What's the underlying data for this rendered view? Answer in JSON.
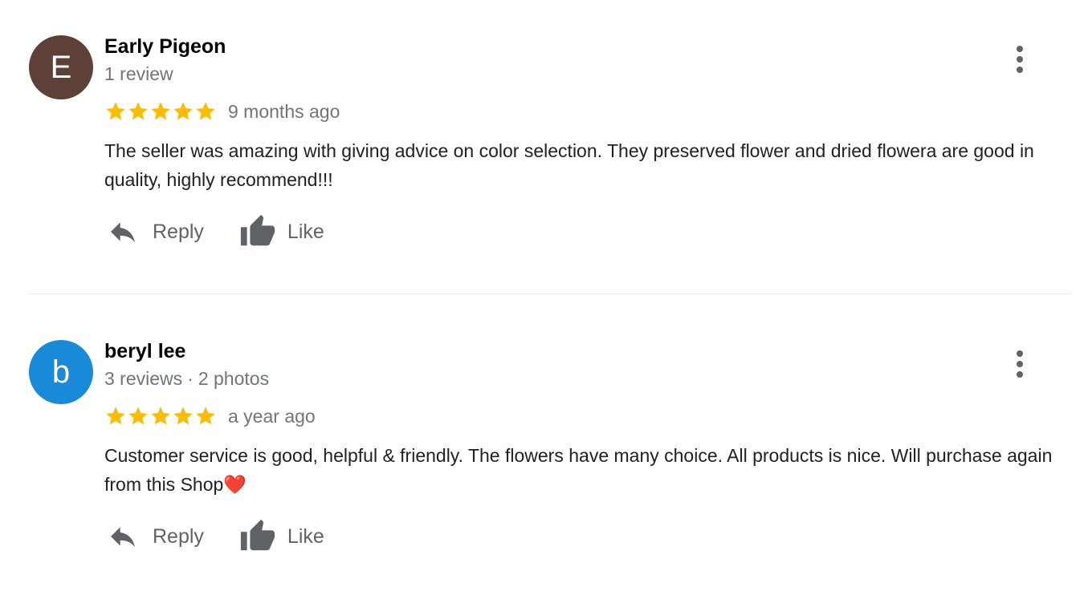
{
  "reviews": [
    {
      "initial": "E",
      "avatar_color": "#5d4037",
      "author": "Early Pigeon",
      "review_count": "1 review",
      "photos": "",
      "rating": 5,
      "age": "9 months ago",
      "text": "The seller was amazing with giving advice on color selection. They preserved flower and dried flowera are good in quality, highly  recommend!!!",
      "reply_label": "Reply",
      "like_label": "Like"
    },
    {
      "initial": "b",
      "avatar_color": "#1a8ad8",
      "author": "beryl lee",
      "review_count": "3 reviews",
      "separator": "·",
      "photos": "2 photos",
      "rating": 5,
      "age": "a year ago",
      "text": "Customer service is good, helpful & friendly. The flowers have many choice. All products is nice. Will purchase again from this Shop❤️",
      "reply_label": "Reply",
      "like_label": "Like"
    }
  ],
  "colors": {
    "star": "#fbbc04",
    "icon": "#5f6368"
  },
  "icons": {
    "reply": "reply-arrow-icon",
    "like": "thumbs-up-icon",
    "more": "more-vert-icon",
    "star": "star-icon"
  }
}
